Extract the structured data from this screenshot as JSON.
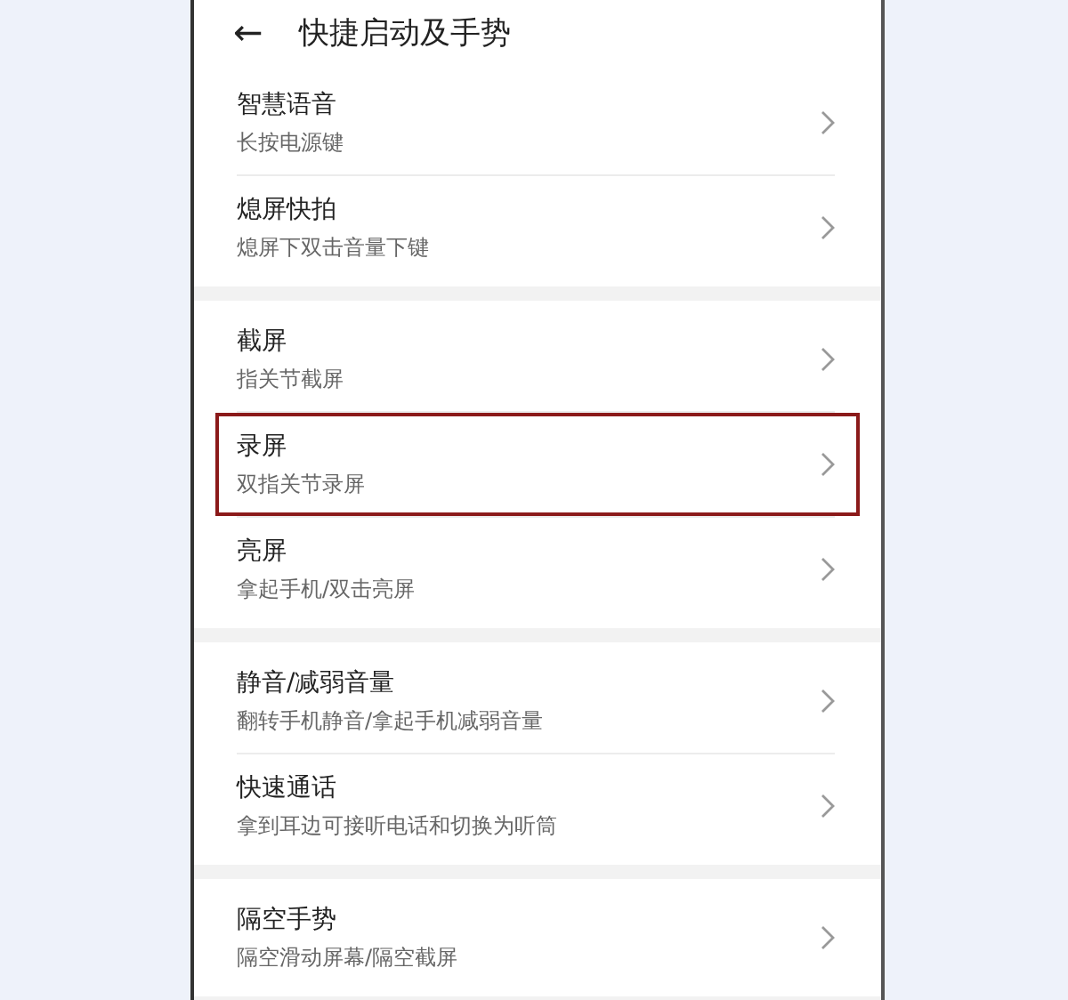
{
  "header": {
    "back_icon": "←",
    "title": "快捷启动及手势"
  },
  "groups": [
    {
      "items": [
        {
          "title": "智慧语音",
          "subtitle": "长按电源键",
          "highlighted": false
        },
        {
          "title": "熄屏快拍",
          "subtitle": "熄屏下双击音量下键",
          "highlighted": false
        }
      ]
    },
    {
      "items": [
        {
          "title": "截屏",
          "subtitle": "指关节截屏",
          "highlighted": false
        },
        {
          "title": "录屏",
          "subtitle": "双指关节录屏",
          "highlighted": true
        },
        {
          "title": "亮屏",
          "subtitle": "拿起手机/双击亮屏",
          "highlighted": false
        }
      ]
    },
    {
      "items": [
        {
          "title": "静音/减弱音量",
          "subtitle": "翻转手机静音/拿起手机减弱音量",
          "highlighted": false
        },
        {
          "title": "快速通话",
          "subtitle": "拿到耳边可接听电话和切换为听筒",
          "highlighted": false
        }
      ]
    },
    {
      "items": [
        {
          "title": "隔空手势",
          "subtitle": "隔空滑动屏幕/隔空截屏",
          "highlighted": false
        }
      ]
    }
  ]
}
